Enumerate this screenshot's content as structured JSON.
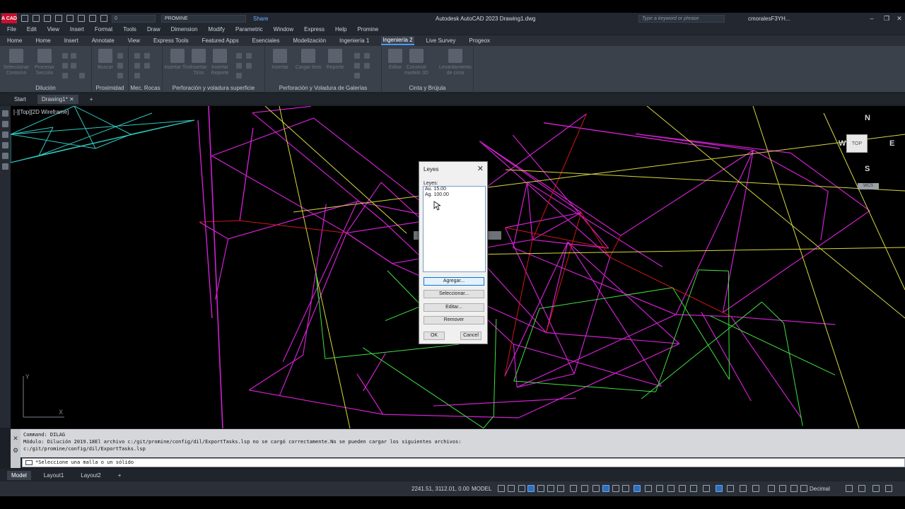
{
  "app": {
    "logo": "A CAD",
    "title": "Autodesk AutoCAD 2023   Drawing1.dwg",
    "workspace": "PROMINE",
    "layer_dd": "0",
    "share": "Share",
    "search_placeholder": "Type a keyword or phrase",
    "user": "cmoralesF3YH..."
  },
  "menu": [
    "File",
    "Edit",
    "View",
    "Insert",
    "Format",
    "Tools",
    "Draw",
    "Dimension",
    "Modify",
    "Parametric",
    "Window",
    "Express",
    "Help",
    "Promine"
  ],
  "ribbon_tabs": [
    "Home",
    "Home",
    "Insert",
    "Annotate",
    "View",
    "Express Tools",
    "Featured Apps",
    "Esenciales",
    "Modelización",
    "Ingeniería 1",
    "Ingeniería 2",
    "Live Survey",
    "Progeox"
  ],
  "ribbon_active_index": 10,
  "ribbon_groups": [
    {
      "title": "Dilución",
      "buttons": [
        "Seleccionar Contorno",
        "Procesar Sección"
      ]
    },
    {
      "title": "Proximidad",
      "buttons": [
        "Buscar"
      ]
    },
    {
      "title": "Mec. Rocas",
      "buttons": []
    },
    {
      "title": "Perforación y voladura superficie",
      "buttons": [
        "Insertar Tiro",
        "Insertar Tiros",
        "Insertar Reporte"
      ]
    },
    {
      "title": "Perforación y Voladura de Galerías",
      "buttons": [
        "Insertar",
        "Cargar tiros",
        "Reporte"
      ]
    },
    {
      "title": "Cinta y Brújula",
      "buttons": [
        "Editar",
        "Construir modelo 3D",
        "Levantamiento de cinta"
      ]
    }
  ],
  "file_tabs": {
    "start": "Start",
    "drawing": "Drawing1*",
    "add": "+"
  },
  "viewport": {
    "label": "[-][Top][2D Wireframe]"
  },
  "viewcube": {
    "top": "TOP",
    "n": "N",
    "s": "S",
    "e": "E",
    "w": "W",
    "wcs": "WCS"
  },
  "dialog": {
    "title": "Leyes",
    "close": "✕",
    "list_label": "Leyes:",
    "items": [
      "Au. 15.00",
      "Ag. 100.00"
    ],
    "btn_add": "Agregar...",
    "btn_select": "Seleccionar...",
    "btn_edit": "Editar...",
    "btn_remove": "Remover",
    "btn_ok": "OK",
    "btn_cancel": "Cancel"
  },
  "command": {
    "line1": "Command: DILAG",
    "line2": "Módulo: Dilución 2019.18El archivo c:/git/promine/config/dil/ExportTasks.lsp no se cargó correctamente.No se pueden cargar los siguientes archivos:",
    "line3": "c:/git/promine/config/dil/ExportTasks.lsp",
    "prompt": "*Seleccione una malla o un sólido"
  },
  "layout_tabs": [
    "Model",
    "Layout1",
    "Layout2",
    "+"
  ],
  "status": {
    "coords": "2241.51, 3112.01, 0.00",
    "model": "MODEL",
    "units": "Decimal"
  },
  "colors": {
    "magenta": "#d020d0",
    "red": "#d01818",
    "yellow": "#d8d840",
    "green": "#40e040",
    "cyan": "#30c8c0",
    "accent": "#4a9bff"
  }
}
